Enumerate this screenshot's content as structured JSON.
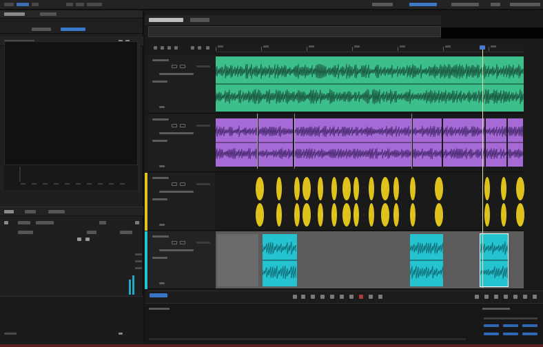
{
  "app": {
    "menubar": {
      "menu_items": [
        "",
        "",
        "",
        "",
        "",
        ""
      ],
      "workspace_tabs": [
        "",
        "",
        "",
        "",
        ""
      ]
    }
  },
  "left_panel": {
    "top_tabs": [
      "",
      ""
    ],
    "source_tabs": [
      "",
      ""
    ],
    "header_field": "",
    "lower_tabs": [
      "",
      "",
      ""
    ],
    "effect_rows": [
      "",
      ""
    ],
    "bottom_label": ""
  },
  "timeline": {
    "tabs": [
      "",
      ""
    ],
    "tracks": [
      {
        "id": "track-1",
        "color": "#3dbf8c",
        "clip_kind": "music",
        "label": ""
      },
      {
        "id": "track-2",
        "color": "#a66ad6",
        "clip_kind": "voice",
        "label": ""
      },
      {
        "id": "track-3",
        "color": "#e0c21d",
        "clip_kind": "sfx",
        "label": ""
      },
      {
        "id": "track-4",
        "color": "#25c2d0",
        "clip_kind": "dialogue",
        "label": ""
      }
    ],
    "timecode": ""
  },
  "bottom_panel": {
    "title": "",
    "right_title": ""
  },
  "colors": {
    "green": "#3dbf8c",
    "purple": "#a66ad6",
    "yellow": "#e0c21d",
    "cyan": "#25c2d0",
    "accent_blue": "#3a78c9"
  }
}
